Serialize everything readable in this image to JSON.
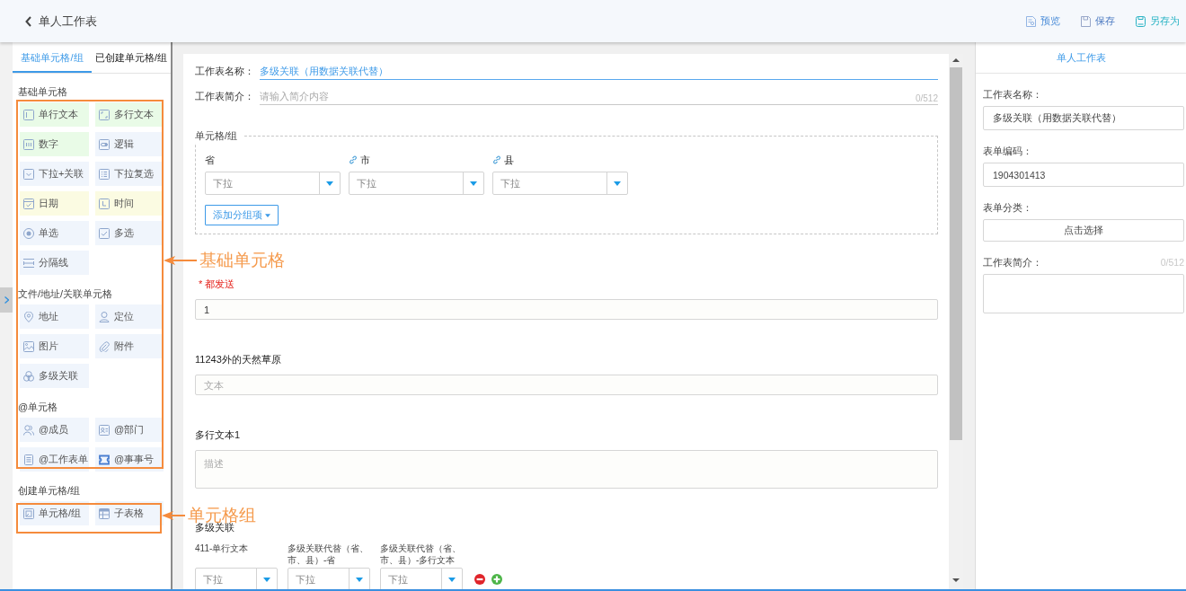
{
  "header": {
    "title": "单人工作表",
    "actions": [
      {
        "kind": "preview",
        "label": "预览"
      },
      {
        "kind": "save",
        "label": "保存"
      },
      {
        "kind": "save_as",
        "label": "另存为"
      }
    ]
  },
  "sidebar": {
    "tabs": [
      {
        "label": "基础单元格/组",
        "selected": true
      },
      {
        "label": "已创建单元格/组",
        "selected": false
      }
    ],
    "sections": [
      {
        "title": "基础单元格",
        "items": [
          {
            "kind": "single_line",
            "label": "单行文本",
            "color": "#e9fbe7"
          },
          {
            "kind": "multi_line",
            "label": "多行文本",
            "color": "#e9fbe7"
          },
          {
            "kind": "number",
            "label": "数字",
            "color": "#e9fbe7"
          },
          {
            "kind": "logic",
            "label": "逻辑",
            "color": "#f0f5fc"
          },
          {
            "kind": "dropdown",
            "label": "下拉+关联",
            "color": "#f0f5fc"
          },
          {
            "kind": "multi_dropdown",
            "label": "下拉复选",
            "color": "#f0f5fc"
          },
          {
            "kind": "date",
            "label": "日期",
            "color": "#fbfbe2"
          },
          {
            "kind": "time",
            "label": "时间",
            "color": "#fbfbe2"
          },
          {
            "kind": "radio",
            "label": "单选",
            "color": "#f0f5fc"
          },
          {
            "kind": "checkbox",
            "label": "多选",
            "color": "#f0f5fc"
          },
          {
            "kind": "divider",
            "label": "分隔线",
            "color": "#f0f5fc"
          }
        ]
      },
      {
        "title": "文件/地址/关联单元格",
        "items": [
          {
            "kind": "address",
            "label": "地址",
            "color": "#f0f5fc"
          },
          {
            "kind": "location",
            "label": "定位",
            "color": "#f0f5fc"
          },
          {
            "kind": "image",
            "label": "图片",
            "color": "#f0f5fc"
          },
          {
            "kind": "attachment",
            "label": "附件",
            "color": "#f0f5fc"
          },
          {
            "kind": "cascade",
            "label": "多级关联",
            "color": "#f0f5fc"
          }
        ]
      },
      {
        "title": "@单元格",
        "items": [
          {
            "kind": "member",
            "label": "@成员",
            "color": "#f0f5fc"
          },
          {
            "kind": "department",
            "label": "@部门",
            "color": "#f0f5fc"
          },
          {
            "kind": "worksheet",
            "label": "@工作表单",
            "color": "#f0f5fc"
          },
          {
            "kind": "ticket",
            "label": "@事事号",
            "color": "#f0f5fc"
          }
        ]
      },
      {
        "title": "创建单元格/组",
        "items": [
          {
            "kind": "cell_group",
            "label": "单元格/组",
            "color": "#f0f5fc"
          },
          {
            "kind": "subtable",
            "label": "子表格",
            "color": "#f0f5fc"
          }
        ]
      }
    ]
  },
  "form": {
    "name": {
      "label": "工作表名称：",
      "value": "多级关联（用数据关联代替）"
    },
    "description": {
      "label": "工作表简介：",
      "placeholder": "请输入简介内容",
      "counter": "0/512"
    },
    "group": {
      "legend": "单元格/组",
      "fields": [
        {
          "label": "省",
          "linked": false,
          "placeholder": "下拉"
        },
        {
          "label": "市",
          "linked": true,
          "placeholder": "下拉"
        },
        {
          "label": "县",
          "linked": true,
          "placeholder": "下拉"
        }
      ],
      "add_button": "添加分组项"
    },
    "fields": [
      {
        "kind": "input",
        "label": "* 都发送",
        "required": true,
        "value": "1"
      },
      {
        "kind": "input",
        "label": "11243外的天然草原",
        "required": false,
        "placeholder": "文本"
      },
      {
        "kind": "textarea",
        "label": "多行文本1",
        "required": false,
        "placeholder": "描述"
      }
    ],
    "cascade": {
      "title": "多级关联",
      "columns": [
        {
          "label": "411-单行文本",
          "placeholder": "下拉"
        },
        {
          "label": "多级关联代替（省、市、县）-省",
          "placeholder": "下拉"
        },
        {
          "label": "多级关联代替（省、市、县）-多行文本",
          "placeholder": "下拉"
        }
      ]
    }
  },
  "properties": {
    "title": "单人工作表",
    "fields": [
      {
        "kind": "input",
        "label": "工作表名称：",
        "value": "多级关联（用数据关联代替）"
      },
      {
        "kind": "input",
        "label": "表单编码：",
        "value": "1904301413"
      },
      {
        "kind": "button",
        "label": "表单分类：",
        "value": "点击选择"
      },
      {
        "kind": "textarea",
        "label": "工作表简介：",
        "counter": "0/512"
      }
    ]
  },
  "annotations": [
    {
      "label": "基础单元格"
    },
    {
      "label": "单元格组"
    }
  ]
}
